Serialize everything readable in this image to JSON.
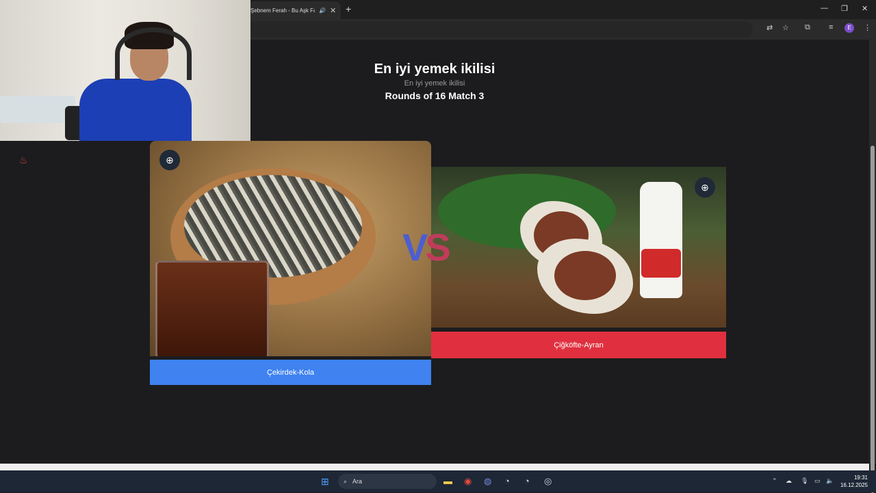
{
  "browser": {
    "tab_title": "Şebnem Ferah - Bu Aşk Fazla",
    "new_tab": "+",
    "profile_initial": "E"
  },
  "page": {
    "title": "En iyi yemek ikilisi",
    "subtitle": "En iyi yemek ikilisi",
    "round_info": "Rounds of 16 Match 3",
    "vs_label": {
      "v": "V",
      "s": "S"
    },
    "options": [
      {
        "label": "Çekirdek-Kola",
        "color": "#3f82f0"
      },
      {
        "label": "Çiğköfte-Ayran",
        "color": "#e0303f"
      }
    ]
  },
  "icons": {
    "zoom": "zoom-in-icon",
    "tab_audio": "speaker-icon",
    "tab_close": "close-icon"
  },
  "taskbar": {
    "search_placeholder": "Ara",
    "time": "19:31",
    "date": "16.12.2025"
  }
}
